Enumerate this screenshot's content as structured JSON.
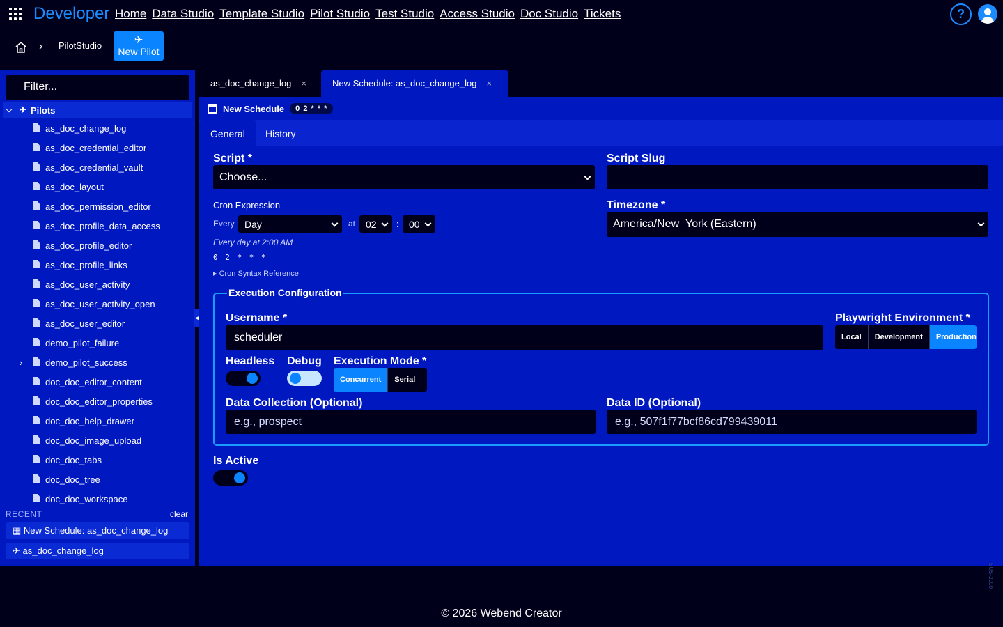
{
  "topnav": {
    "brand": "Developer",
    "links": [
      "Home",
      "Data Studio",
      "Template Studio",
      "Pilot Studio",
      "Test Studio",
      "Access Studio",
      "Doc Studio",
      "Tickets"
    ],
    "help_label": "?"
  },
  "breadcrumb": {
    "separator": "›",
    "current": "PilotStudio"
  },
  "new_pilot": {
    "icon": "✈",
    "label": "New Pilot"
  },
  "sidebar": {
    "filter_placeholder": "Filter...",
    "root": {
      "chevron": "⌵",
      "icon": "✈",
      "label": "Pilots"
    },
    "items": [
      "as_doc_change_log",
      "as_doc_credential_editor",
      "as_doc_credential_vault",
      "as_doc_layout",
      "as_doc_permission_editor",
      "as_doc_profile_data_access",
      "as_doc_profile_editor",
      "as_doc_profile_links",
      "as_doc_user_activity",
      "as_doc_user_activity_open",
      "as_doc_user_editor",
      "demo_pilot_failure",
      "demo_pilot_success",
      "doc_doc_editor_content",
      "doc_doc_editor_properties",
      "doc_doc_help_drawer",
      "doc_doc_image_upload",
      "doc_doc_tabs",
      "doc_doc_tree",
      "doc_doc_workspace"
    ],
    "expandable_item_marker": "›",
    "recent_header": "RECENT",
    "recent_clear": "clear",
    "recent": [
      {
        "icon": "▦",
        "label": "New Schedule: as_doc_change_log"
      },
      {
        "icon": "✈",
        "label": "as_doc_change_log"
      }
    ],
    "toggle_glyph": "◀"
  },
  "tabs": [
    {
      "label": "as_doc_change_log",
      "close": "×"
    },
    {
      "label": "New Schedule: as_doc_change_log",
      "close": "×"
    }
  ],
  "schedule": {
    "title": "New Schedule",
    "cron_pill": "0 2 * * *",
    "subtabs": [
      "General",
      "History"
    ],
    "script": {
      "label": "Script *",
      "value": "Choose..."
    },
    "script_slug": {
      "label": "Script Slug",
      "value": ""
    },
    "cron": {
      "label": "Cron Expression",
      "every_label": "Every",
      "frequency": "Day",
      "at_label": "at",
      "hour": "02",
      "colon": ":",
      "minute": "00",
      "description": "Every day at 2:00 AM",
      "expression": "0 2 * * *",
      "reference": "▸ Cron Syntax Reference"
    },
    "timezone": {
      "label": "Timezone *",
      "value": "America/New_York (Eastern)"
    },
    "execution": {
      "legend": "Execution Configuration",
      "username": {
        "label": "Username *",
        "value": "scheduler"
      },
      "environment": {
        "label": "Playwright Environment *",
        "options": [
          "Local",
          "Development",
          "Production"
        ],
        "selected": "Production"
      },
      "headless": {
        "label": "Headless",
        "on": true
      },
      "debug": {
        "label": "Debug",
        "on": false
      },
      "mode": {
        "label": "Execution Mode *",
        "options": [
          "Concurrent",
          "Serial"
        ],
        "selected": "Concurrent"
      },
      "data_collection": {
        "label": "Data Collection (Optional)",
        "placeholder": "e.g., prospect"
      },
      "data_id": {
        "label": "Data ID (Optional)",
        "placeholder": "e.g., 507f1f77bcf86cd799439011"
      }
    },
    "is_active": {
      "label": "Is Active",
      "on": true
    }
  },
  "footer": {
    "text": "© 2026 Webend Creator",
    "version": "EUS-2000"
  },
  "colors": {
    "accent": "#0a84ff",
    "panel": "#0018c0",
    "background": "#00001a"
  }
}
